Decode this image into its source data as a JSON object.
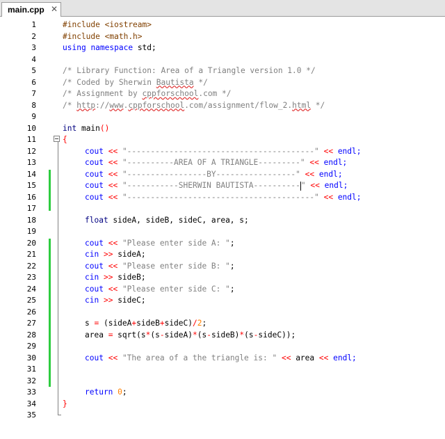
{
  "tab": {
    "label": "main.cpp",
    "close_glyph": "✕",
    "close_icon": "close-icon"
  },
  "line_numbers": [
    "1",
    "2",
    "3",
    "4",
    "5",
    "6",
    "7",
    "8",
    "9",
    "10",
    "11",
    "12",
    "13",
    "14",
    "15",
    "16",
    "17",
    "18",
    "19",
    "20",
    "21",
    "22",
    "23",
    "24",
    "25",
    "26",
    "27",
    "28",
    "29",
    "30",
    "31",
    "32",
    "33",
    "34",
    "35"
  ],
  "code": {
    "l1_dir": "#include",
    "l1_file": "<iostream>",
    "l2_dir": "#include",
    "l2_file": "<math.h>",
    "l3_using": "using",
    "l3_ns": "namespace",
    "l3_std": "std;",
    "l5": "/* Library Function: Area of a Triangle version 1.0 */",
    "l6_a": "/* Coded by Sherwin ",
    "l6_b": "Bautista",
    "l6_c": " */",
    "l7_a": "/* Assignment by ",
    "l7_b": "cppforschool",
    "l7_c": ".com */",
    "l8_a": "/* ",
    "l8_b": "http",
    "l8_c": "://",
    "l8_d": "www",
    "l8_e": ".",
    "l8_f": "cppforschool",
    "l8_g": ".com/assignment/flow_2.",
    "l8_h": "html",
    "l8_i": " */",
    "l10_int": "int",
    "l10_main": " main",
    "l10_paren": "()",
    "l11": "{",
    "cout": "cout",
    "endl": "endl;",
    "shl": "<<",
    "shr": ">>",
    "cin": "cin",
    "l12_str": "\"----------------------------------------\"",
    "l13_str": "\"----------AREA OF A TRIANGLE---------\"",
    "l14_str": "\"-----------------BY-----------------\"",
    "l15_str_a": "\"-----------SHERWIN BAUTISTA----------",
    "l15_str_b": "\"",
    "l16_str": "\"----------------------------------------\"",
    "l18_float": "float",
    "l18_vars": " sideA, sideB, sideC, area, s;",
    "l20_str": "\"Please enter side A: \"",
    "l21_var": " sideA;",
    "l22_str": "\"Please enter side B: \"",
    "l23_var": " sideB;",
    "l24_str": "\"Please enter side C: \"",
    "l25_var": " sideC;",
    "l27_a": "s ",
    "l27_eq": "=",
    "l27_b": " (sideA",
    "l27_p1": "+",
    "l27_c": "sideB",
    "l27_p2": "+",
    "l27_d": "sideC)",
    "l27_div": "/",
    "l27_num": "2",
    "l27_end": ";",
    "l28_a": "area ",
    "l28_eq": "=",
    "l28_b": " sqrt(s",
    "l28_m1": "*",
    "l28_c": "(s",
    "l28_s1": "-",
    "l28_d": "sideA)",
    "l28_m2": "*",
    "l28_e": "(s",
    "l28_s2": "-",
    "l28_f": "sideB)",
    "l28_m3": "*",
    "l28_g": "(s",
    "l28_s3": "-",
    "l28_h": "sideC));",
    "l30_str": "\"The area of a the triangle is: \"",
    "l30_area": " area ",
    "l33_ret": "return",
    "l33_num": "0",
    "l33_end": ";",
    "l34": "}"
  },
  "colors": {
    "changebar": "#2ecc40",
    "keyword": "#0000ff",
    "string": "#808080",
    "operator": "#ff0000",
    "number": "#ff8000",
    "preprocessor": "#804000"
  }
}
